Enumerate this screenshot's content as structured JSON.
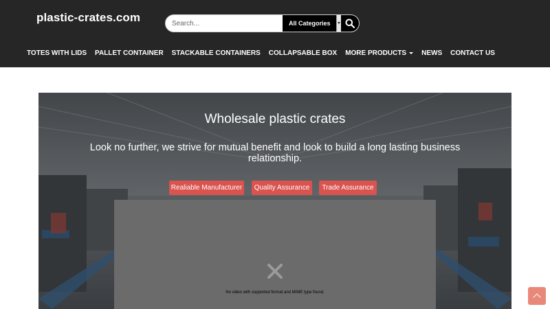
{
  "site": {
    "logo_text": "plastic-crates.com"
  },
  "search": {
    "placeholder": "Search...",
    "category_selected": "All Categories",
    "button_icon": "search-icon"
  },
  "nav": {
    "items": [
      {
        "label": "TOTES WITH LIDS"
      },
      {
        "label": "PALLET CONTAINER"
      },
      {
        "label": "STACKABLE CONTAINERS"
      },
      {
        "label": "COLLAPSABLE BOX"
      },
      {
        "label": "MORE PRODUCTS"
      },
      {
        "label": "NEWS"
      },
      {
        "label": "CONTACT US"
      }
    ]
  },
  "hero": {
    "title": "Wholesale plastic crates",
    "subtitle": "Look no further, we strive for mutual benefit and look to build a long lasting business relationship.",
    "buttons": [
      {
        "label": "Realiable Manufacturer"
      },
      {
        "label": "Quality Assurance"
      },
      {
        "label": "Trade Assurance"
      }
    ]
  },
  "video": {
    "error_message": "No video with supported format and MIME type found."
  },
  "colors": {
    "header_bg": "#262626",
    "accent": "#d9534f",
    "back_to_top": "#e8887a"
  }
}
